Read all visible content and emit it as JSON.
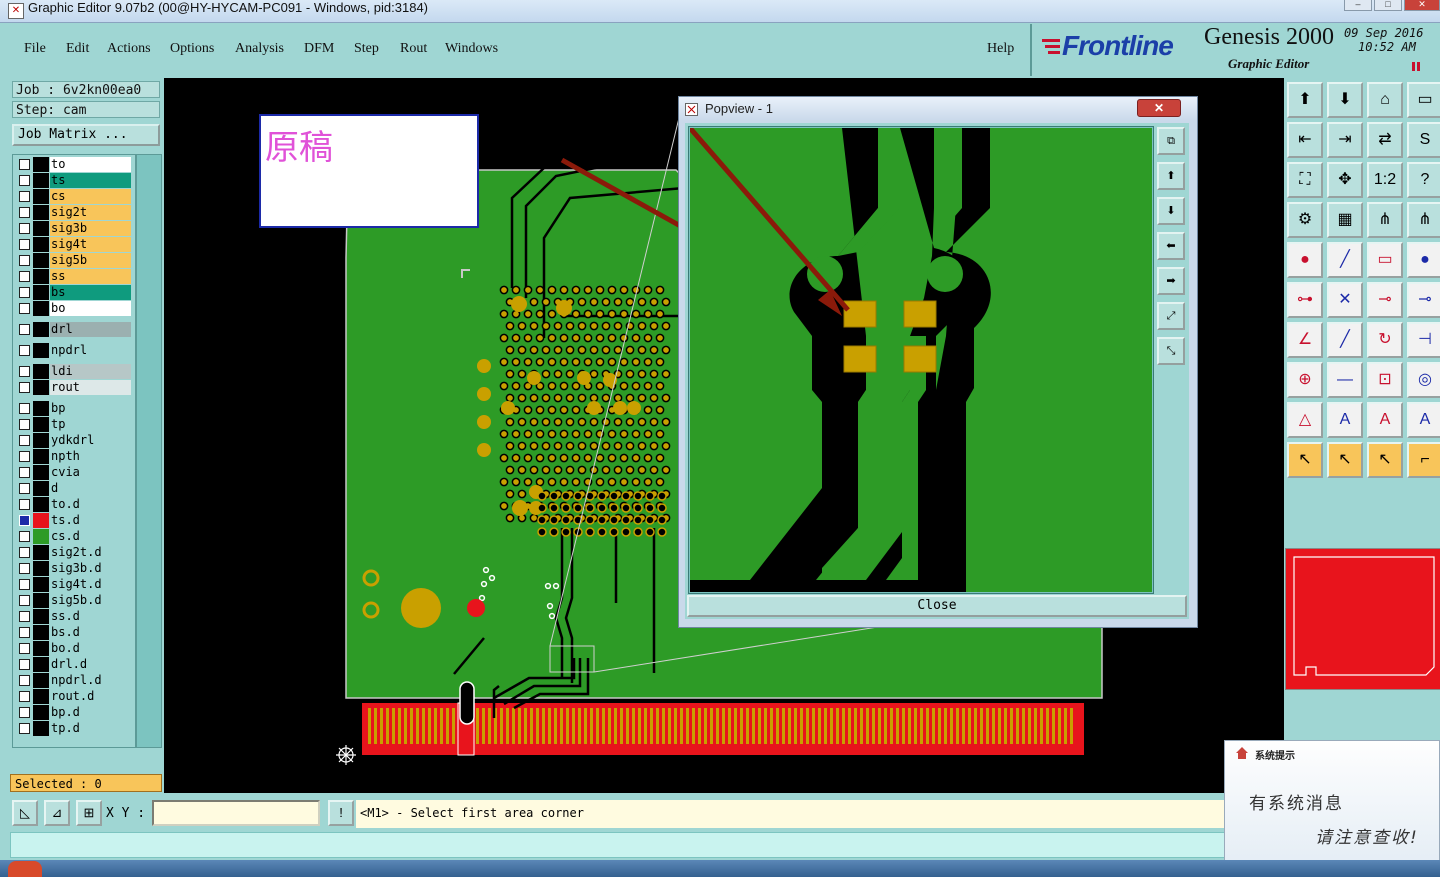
{
  "window": {
    "title": "Graphic Editor 9.07b2 (00@HY-HYCAM-PC091 - Windows, pid:3184)"
  },
  "menu": [
    "File",
    "Edit",
    "Actions",
    "Options",
    "Analysis",
    "DFM",
    "Step",
    "Rout",
    "Windows"
  ],
  "help_label": "Help",
  "brand": {
    "logo": "Frontline",
    "product": "Genesis 2000",
    "subtitle": "Graphic Editor",
    "date_line1": "09  Sep 2016",
    "date_line2": "10:52  AM"
  },
  "job": {
    "job_line": "Job : 6v2kn00ea0",
    "step_line": "Step: cam",
    "job_matrix_label": "Job Matrix ..."
  },
  "layers": [
    {
      "name": "to",
      "color": "#ffffff"
    },
    {
      "name": "ts",
      "color": "#0f9b7e"
    },
    {
      "name": "cs",
      "color": "#f8c55a"
    },
    {
      "name": "sig2t",
      "color": "#f8c55a"
    },
    {
      "name": "sig3b",
      "color": "#f8c55a"
    },
    {
      "name": "sig4t",
      "color": "#f8c55a"
    },
    {
      "name": "sig5b",
      "color": "#f8c55a"
    },
    {
      "name": "ss",
      "color": "#f8c55a"
    },
    {
      "name": "bs",
      "color": "#0f9b7e"
    },
    {
      "name": "bo",
      "color": "#ffffff"
    },
    {
      "name": "drl",
      "color": "#9bb0b0",
      "gap": true
    },
    {
      "name": "npdrl",
      "color": "#9fd6d3",
      "gap": true
    },
    {
      "name": "ldi",
      "color": "#b6c7c7",
      "gap": true
    },
    {
      "name": "rout",
      "color": "#dde8e8"
    },
    {
      "name": "bp",
      "color": "#9fd6d3",
      "gap": true
    },
    {
      "name": "tp",
      "color": "#9fd6d3"
    },
    {
      "name": "ydkdrl",
      "color": "#9fd6d3"
    },
    {
      "name": "npth",
      "color": "#9fd6d3"
    },
    {
      "name": "cvia",
      "color": "#9fd6d3"
    },
    {
      "name": "d",
      "color": "#9fd6d3"
    },
    {
      "name": "to.d",
      "color": "#9fd6d3"
    },
    {
      "name": "ts.d",
      "color": "#9fd6d3",
      "swatch": "#e8141c",
      "active": true
    },
    {
      "name": "cs.d",
      "color": "#9fd6d3",
      "swatch": "#2d9b26"
    },
    {
      "name": "sig2t.d",
      "color": "#9fd6d3"
    },
    {
      "name": "sig3b.d",
      "color": "#9fd6d3"
    },
    {
      "name": "sig4t.d",
      "color": "#9fd6d3"
    },
    {
      "name": "sig5b.d",
      "color": "#9fd6d3"
    },
    {
      "name": "ss.d",
      "color": "#9fd6d3"
    },
    {
      "name": "bs.d",
      "color": "#9fd6d3"
    },
    {
      "name": "bo.d",
      "color": "#9fd6d3"
    },
    {
      "name": "drl.d",
      "color": "#9fd6d3"
    },
    {
      "name": "npdrl.d",
      "color": "#9fd6d3"
    },
    {
      "name": "rout.d",
      "color": "#9fd6d3"
    },
    {
      "name": "bp.d",
      "color": "#9fd6d3"
    },
    {
      "name": "tp.d",
      "color": "#9fd6d3"
    }
  ],
  "selected": "Selected : 0",
  "annotation_text": "原稿",
  "popview": {
    "title": "Popview - 1",
    "close_label": "Close"
  },
  "bottom": {
    "xy_label": "X Y :",
    "xy_value": "",
    "message": "<M1> - Select first area corner"
  },
  "notification": {
    "title": "系统提示",
    "line1": "有系统消息",
    "line2": "请注意查收!"
  },
  "colors": {
    "board_green": "#2d9b26",
    "pad_gold": "#c9a000",
    "trace_black": "#000000",
    "accent_red": "#e8141c"
  }
}
